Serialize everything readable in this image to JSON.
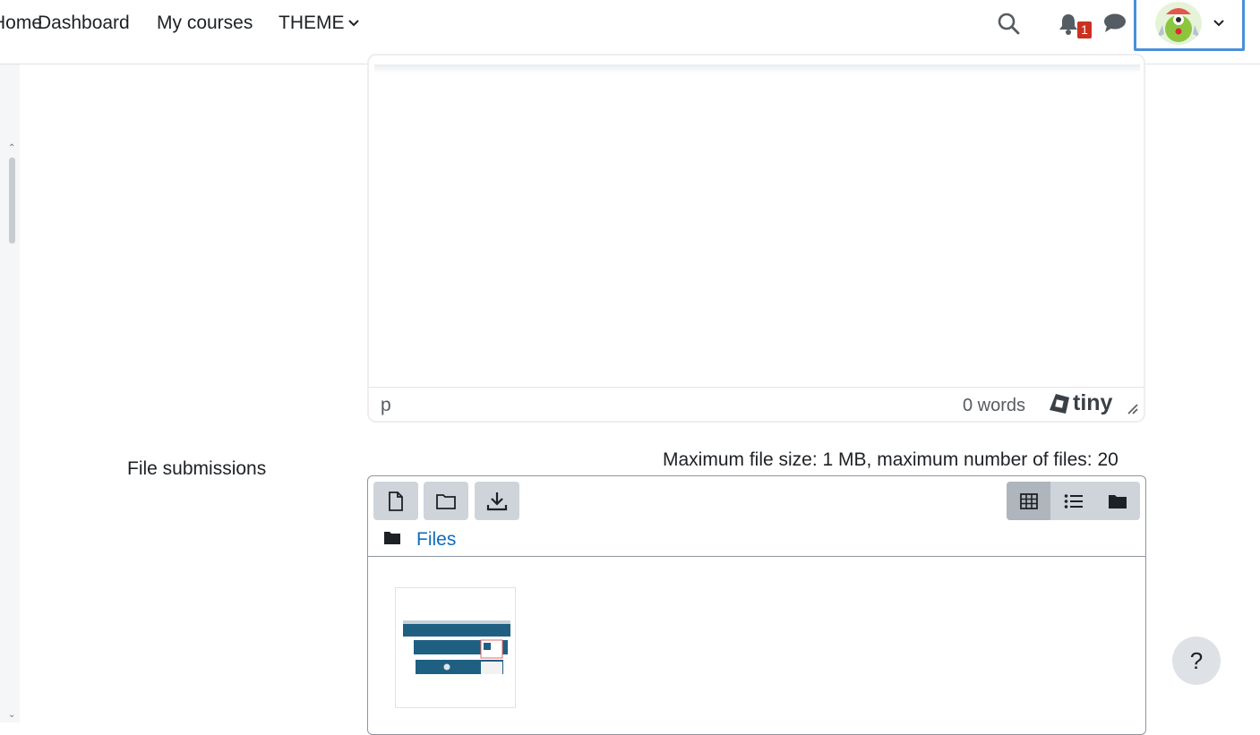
{
  "navbar": {
    "home_label": "Home",
    "dashboard_label": "Dashboard",
    "my_courses_label": "My courses",
    "theme_label": "THEME",
    "notifications_count": "1"
  },
  "editor": {
    "status_path": "p",
    "word_count": "0 words",
    "brand": "tiny"
  },
  "file_submissions": {
    "label": "File submissions",
    "limits": "Maximum file size: 1 MB, maximum number of files: 20",
    "path_root": "Files",
    "files": [
      {
        "type": "image-thumbnail"
      }
    ]
  },
  "help": {
    "label": "?"
  },
  "colors": {
    "link": "#0f6cbf",
    "badge": "#ca3120",
    "focus_border": "#4a8fd9",
    "button_bg": "#ced4da"
  }
}
